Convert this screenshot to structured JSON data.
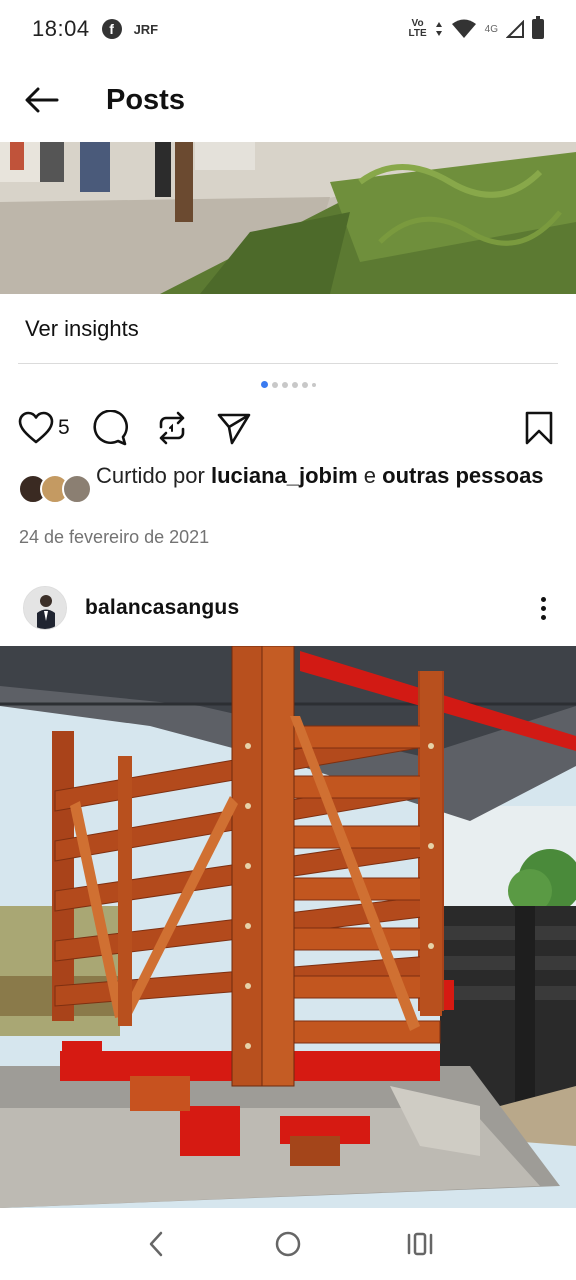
{
  "status_bar": {
    "time": "18:04",
    "notification_app": "f",
    "notification_text": "JRF",
    "volte_line1": "Vo",
    "volte_line2": "LTE",
    "network": "4G",
    "icons": [
      "facebook-icon",
      "data-arrows-icon",
      "wifi-icon",
      "signal-icon",
      "battery-icon"
    ]
  },
  "header": {
    "title": "Posts",
    "back_icon": "arrow-left-icon"
  },
  "post": {
    "insights_label": "Ver insights",
    "carousel": {
      "count": 6,
      "active_index": 0
    },
    "likes_count": "5",
    "liked_by_prefix": "Curtido por ",
    "liked_by_user": "luciana_jobim",
    "liked_by_middle": " e ",
    "liked_by_rest": "outras pessoas",
    "date": "24 de fevereiro de 2021",
    "action_icons": [
      "heart-icon",
      "comment-icon",
      "repost-icon",
      "send-icon",
      "bookmark-icon"
    ]
  },
  "next_post": {
    "username": "balancasangus",
    "more_icon": "more-vertical-icon"
  },
  "nav_bar": {
    "icons": [
      "back-nav-icon",
      "home-nav-icon",
      "recents-nav-icon"
    ]
  },
  "colors": {
    "accent_dot": "#3a7bf0",
    "text_secondary": "#737373",
    "crate_wood": "#b34a1c",
    "crate_red": "#d61a12"
  }
}
